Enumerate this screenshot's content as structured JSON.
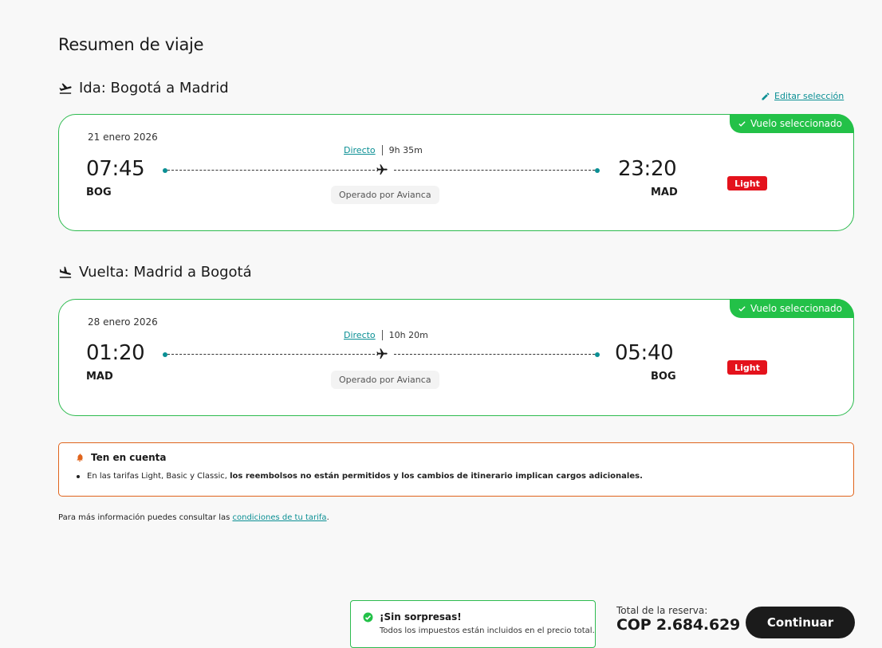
{
  "page_title": "Resumen de viaje",
  "edit_selection": "Editar selección",
  "outbound": {
    "title": "Ida: Bogotá a Madrid",
    "date": "21 enero 2026",
    "departure_time": "07:45",
    "departure_code": "BOG",
    "arrival_time": "23:20",
    "arrival_code": "MAD",
    "route_type": "Directo",
    "duration": "9h 35m",
    "operated_by": "Operado por Avianca",
    "fare": "Light",
    "selected_label": "Vuelo seleccionado"
  },
  "return": {
    "title": "Vuelta: Madrid a Bogotá",
    "date": "28 enero 2026",
    "departure_time": "01:20",
    "departure_code": "MAD",
    "arrival_time": "05:40",
    "arrival_code": "BOG",
    "route_type": "Directo",
    "duration": "10h 20m",
    "operated_by": "Operado por Avianca",
    "fare": "Light",
    "selected_label": "Vuelo seleccionado"
  },
  "notice": {
    "title": "Ten en cuenta",
    "text_plain": "En las tarifas Light, Basic y Classic, ",
    "text_bold": "los reembolsos no están permitidos y los cambios de itinerario implican cargos adicionales."
  },
  "more_info": {
    "text": "Para más información puedes consultar las ",
    "link": "condiciones de tu tarifa",
    "suffix": "."
  },
  "summary": {
    "no_surprises_title": "¡Sin sorpresas!",
    "no_surprises_text": "Todos los impuestos están incluidos en el precio total.",
    "total_label": "Total de la reserva:",
    "total_amount": "COP 2.684.629",
    "continue_label": "Continuar"
  },
  "icons": {
    "takeoff": "airplane-takeoff-icon",
    "landing": "airplane-landing-icon",
    "edit": "pencil-icon",
    "check": "check-icon",
    "plane": "airplane-icon",
    "bell": "bell-icon",
    "check_circle": "check-circle-icon"
  },
  "colors": {
    "accent_teal": "#0a8f94",
    "selected_green": "#23c148",
    "card_border": "#2dbb4f",
    "fare_red": "#e4121c",
    "notice_border": "#e0641c",
    "button_dark": "#1b1b1b"
  }
}
